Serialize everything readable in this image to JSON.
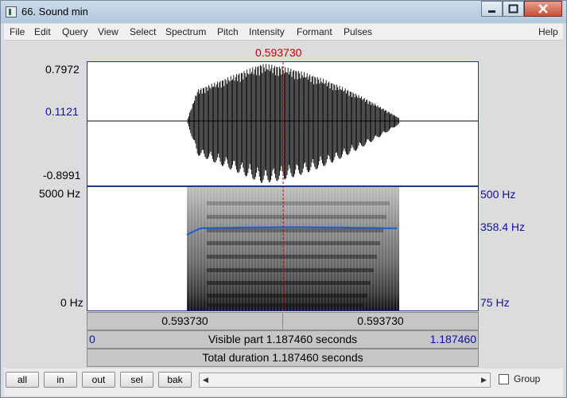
{
  "window": {
    "title": "66. Sound min"
  },
  "menu": [
    "File",
    "Edit",
    "Query",
    "View",
    "Select",
    "Spectrum",
    "Pitch",
    "Intensity",
    "Formant",
    "Pulses",
    "Help"
  ],
  "cursor": {
    "time_label": "0.593730"
  },
  "waveform": {
    "y_max": "0.7972",
    "y_value": "0.1121",
    "y_min": "-0.8991"
  },
  "spectrogram": {
    "freq_max": "5000 Hz",
    "freq_min": "0 Hz"
  },
  "pitch": {
    "top": "500 Hz",
    "value": "358.4 Hz",
    "bottom": "75 Hz"
  },
  "time_info": {
    "left_segment": "0.593730",
    "right_segment": "0.593730",
    "visible_start": "0",
    "visible_end": "1.187460",
    "visible_label": "Visible part 1.187460 seconds",
    "total_label": "Total duration 1.187460 seconds"
  },
  "buttons": {
    "all": "all",
    "in": "in",
    "out": "out",
    "sel": "sel",
    "bak": "bak"
  },
  "group_label": "Group",
  "colors": {
    "cursor": "#c00000",
    "pitch_curve": "#1a5ad8",
    "axis_blue": "#1010a0"
  }
}
